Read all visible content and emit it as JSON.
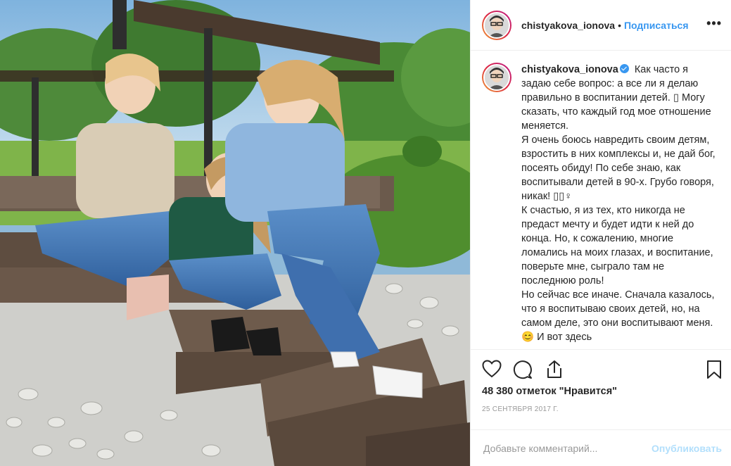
{
  "post": {
    "username": "chistyakova_ionova",
    "dot": "•",
    "follow_label": "Подписаться",
    "more_label": "•••",
    "caption_paragraphs": [
      "Как часто я задаю себе вопрос: а все ли я делаю правильно в воспитании детей. ▯ Могу сказать, что каждый год мое отношение меняется.",
      "Я очень боюсь навредить своим детям, взростить в них комплексы и, не дай бог, посеять обиду! По себе знаю, как воспитывали детей в 90-х. Грубо говоря, никак! ▯▯♀",
      "К счастью, я из тех, кто никогда не предаст мечту и будет идти к ней до конца. Но, к сожалению, многие ломались на моих глазах, и воспитание, поверьте мне, сыграло там не последнюю роль!",
      "Но сейчас все иначе. Сначала казалось, что я воспитываю своих детей, но, на самом деле, это они воспитывают меня. 😊 И вот здесь"
    ],
    "likes_text": "48 380 отметок \"Нравится\"",
    "date_text": "25 СЕНТЯБРЯ 2017 Г.",
    "comment_placeholder": "Добавьте комментарий...",
    "publish_label": "Опубликовать"
  },
  "icons": [
    "heart-icon",
    "comment-icon",
    "share-icon",
    "bookmark-icon",
    "verified-badge-icon",
    "more-options-icon"
  ],
  "colors": {
    "link_blue": "#3897f0",
    "publish_disabled": "#b2dffc",
    "muted_text": "#999999",
    "border": "#efefef"
  }
}
